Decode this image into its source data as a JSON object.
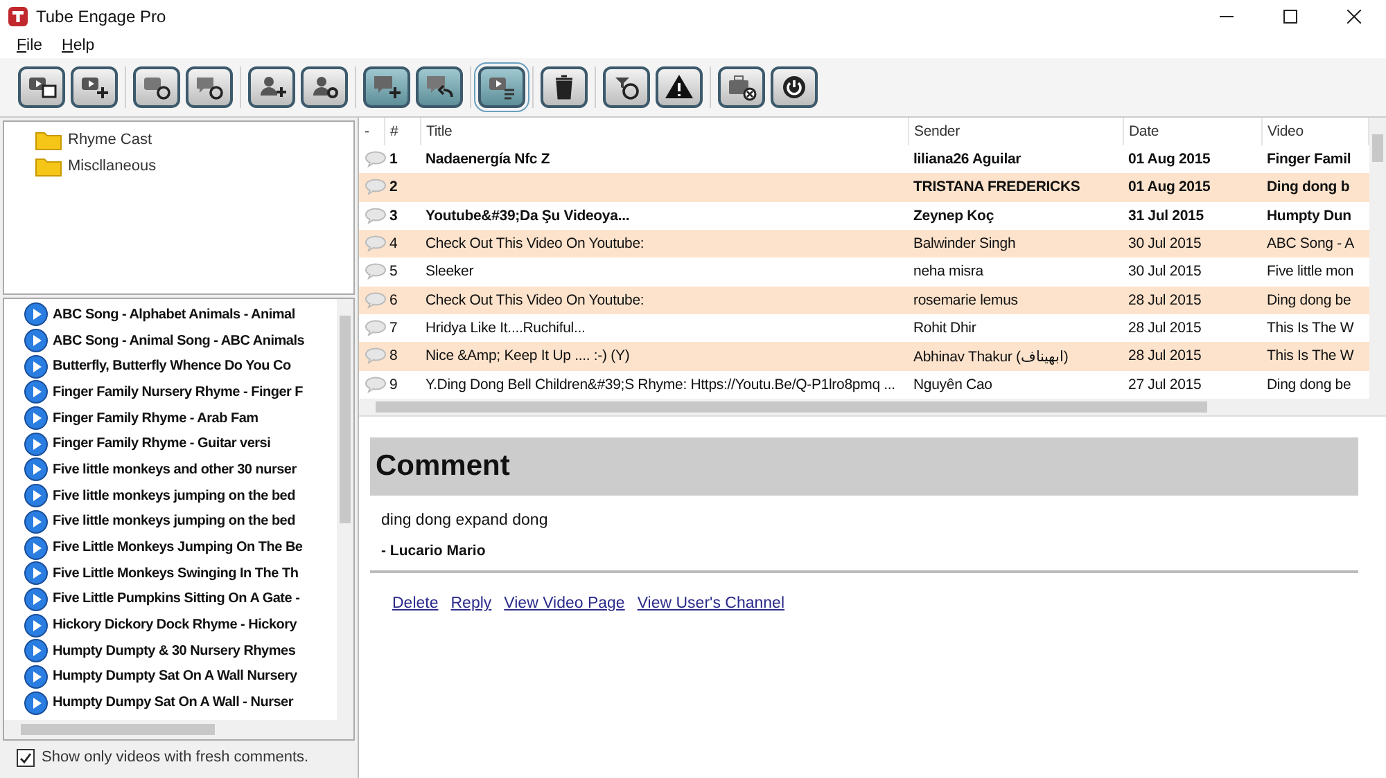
{
  "window": {
    "title": "Tube Engage Pro"
  },
  "menu": [
    {
      "label": "File"
    },
    {
      "label": "Help"
    }
  ],
  "toolbar": {
    "groups": [
      {
        "buttons": [
          {
            "selected": false
          },
          {
            "selected": false
          }
        ]
      },
      {
        "buttons": [
          {
            "selected": false
          },
          {
            "selected": false
          }
        ]
      },
      {
        "buttons": [
          {
            "selected": false
          },
          {
            "selected": false
          }
        ]
      },
      {
        "buttons": [
          {
            "selected": false
          },
          {
            "selected": false
          }
        ]
      },
      {
        "buttons": [
          {
            "selected": true
          }
        ]
      },
      {
        "buttons": [
          {
            "selected": false
          }
        ]
      },
      {
        "buttons": [
          {
            "selected": false
          },
          {
            "selected": false
          }
        ]
      },
      {
        "buttons": [
          {
            "selected": false
          },
          {
            "selected": false
          }
        ]
      }
    ]
  },
  "folders": [
    {
      "label": "Rhyme Cast"
    },
    {
      "label": "Miscllaneous"
    }
  ],
  "videos": [
    "ABC Song - Alphabet Animals - Animal",
    "ABC Song - Animal Song - ABC Animals",
    "Butterfly, Butterfly Whence Do You Co",
    "Finger Family Nursery Rhyme - Finger F",
    "Finger Family Rhyme - Arab Fam",
    "Finger Family Rhyme - Guitar versi",
    "Five little monkeys and other 30 nurser",
    "Five little monkeys jumping on the bed",
    "Five little monkeys jumping on the bed",
    "Five Little Monkeys Jumping On The Be",
    "Five Little Monkeys Swinging In The Th",
    "Five Little Pumpkins Sitting On A Gate -",
    "Hickory Dickory Dock Rhyme - Hickory",
    "Humpty Dumpty & 30 Nursery Rhymes",
    "Humpty Dumpty Sat On A Wall Nursery",
    "Humpty Dumpy Sat On A Wall  - Nurser"
  ],
  "filter": {
    "label": "Show only videos with fresh comments.",
    "checked": true
  },
  "table": {
    "columns": [
      "-",
      "#",
      "Title",
      "Sender",
      "Date",
      "Video"
    ],
    "rows": [
      {
        "number": "1",
        "title": "Nadaenergía Nfc Z",
        "sender": "liliana26 Aguilar",
        "date": "01 Aug 2015",
        "video": "Finger Famil",
        "unread": true
      },
      {
        "number": "2",
        "sender": "TRISTANA FREDERICKS",
        "date": "01 Aug 2015",
        "video": "Ding dong b",
        "unread": true
      },
      {
        "number": "3",
        "title": "Youtube&#39;Da Şu Videoya...",
        "sender": "Zeynep Koç",
        "date": "31 Jul 2015",
        "video": "Humpty Dun",
        "unread": true
      },
      {
        "number": "4",
        "title": "Check Out This Video On Youtube:",
        "sender": "Balwinder Singh",
        "date": "30 Jul 2015",
        "video": "ABC Song - A",
        "unread": false
      },
      {
        "number": "5",
        "title": "Sleeker",
        "sender": "neha misra",
        "date": "30 Jul 2015",
        "video": "Five little mon",
        "unread": false
      },
      {
        "number": "6",
        "title": "Check Out This Video On Youtube:",
        "sender": "rosemarie lemus",
        "date": "28 Jul 2015",
        "video": "Ding dong be",
        "unread": false
      },
      {
        "number": "7",
        "title": "Hridya Like It....Ruchiful...",
        "sender": "Rohit Dhir",
        "date": "28 Jul 2015",
        "video": "This Is The W",
        "unread": false
      },
      {
        "number": "8",
        "title": "Nice &Amp; Keep It Up .... :-) (Y)",
        "sender": "Abhinav Thakur (ابهيناف)",
        "date": "28 Jul 2015",
        "video": "This Is The W",
        "unread": false
      },
      {
        "number": "9",
        "title": "Y.Ding Dong Bell Children&#39;S Rhyme: Https://Youtu.Be/Q-P1lro8pmq ...",
        "sender": "Nguyên Cao",
        "date": "27 Jul 2015",
        "video": "Ding dong be",
        "unread": false
      }
    ]
  },
  "comment": {
    "heading": "Comment",
    "text": "ding dong expand dong",
    "author": "- Lucario Mario",
    "links": [
      "Delete",
      "Reply",
      "View Video Page",
      "View User's Channel"
    ]
  }
}
